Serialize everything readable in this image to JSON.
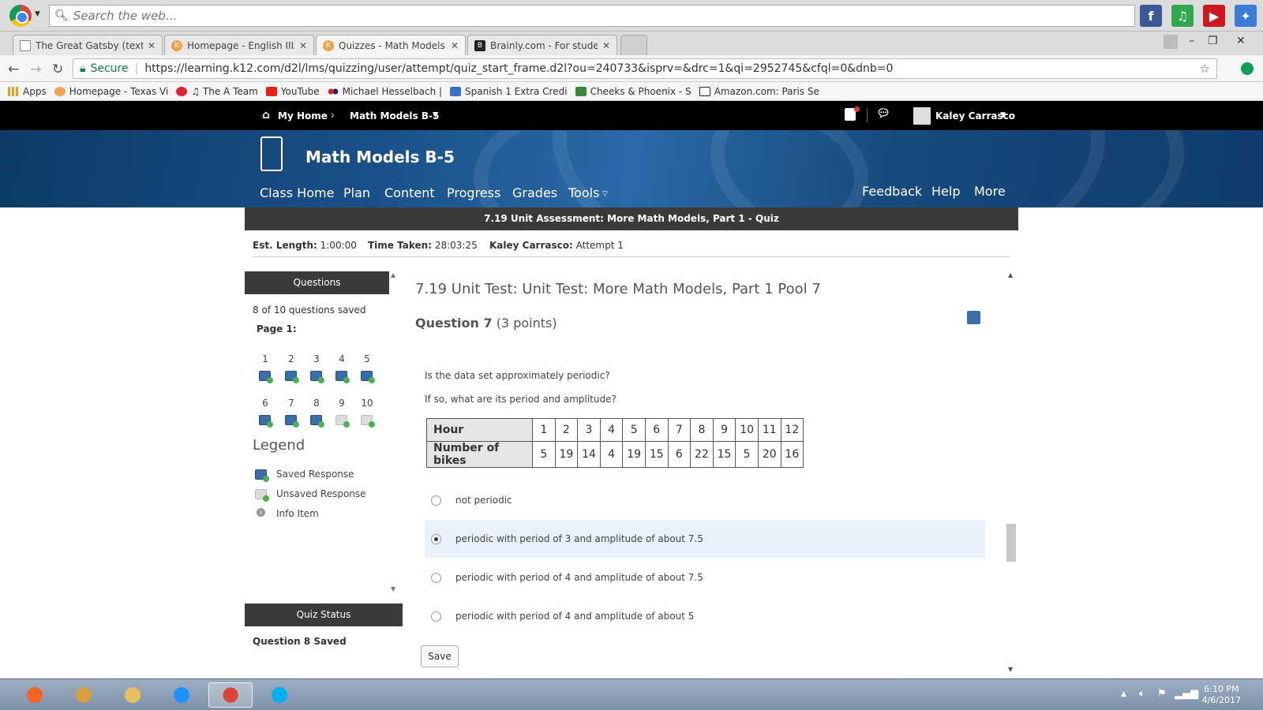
{
  "browser": {
    "search_placeholder": "Search the web...",
    "tabs": [
      {
        "title": "The Great Gatsby (text).p"
      },
      {
        "title": "Homepage - English IIIA"
      },
      {
        "title": "Quizzes - Math Models E"
      },
      {
        "title": "Brainly.com - For studen"
      }
    ],
    "secure_label": "Secure",
    "url": "https://learning.k12.com/d2l/lms/quizzing/user/attempt/quiz_start_frame.d2l?ou=240733&isprv=&drc=1&qi=2952745&cfql=0&dnb=0",
    "bookmarks": [
      {
        "label": "Apps",
        "color": "#e0a020"
      },
      {
        "label": "Homepage - Texas Vi",
        "color": "#f1a34b"
      },
      {
        "label": "♫ The A Team",
        "color": "#d23"
      },
      {
        "label": "YouTube",
        "color": "#e62117"
      },
      {
        "label": "Michael Hesselbach |",
        "color": "#c22"
      },
      {
        "label": "Spanish 1 Extra Credi",
        "color": "#3a6fc4"
      },
      {
        "label": "Cheeks & Phoenix - S",
        "color": "#3a8a3a"
      },
      {
        "label": "Amazon.com: Paris Se",
        "color": "#222"
      }
    ]
  },
  "site": {
    "my_home": "My Home",
    "course_dropdown": "Math Models B-5",
    "user_name": "Kaley Carrasco",
    "course_title": "Math Models B-5",
    "menu_left": [
      "Class Home",
      "Plan",
      "Content",
      "Progress",
      "Grades",
      "Tools"
    ],
    "menu_right": [
      "Feedback",
      "Help",
      "More"
    ]
  },
  "quiz": {
    "header": "7.19 Unit Assessment: More Math Models, Part 1 - Quiz",
    "est_length_label": "Est. Length:",
    "est_length": "1:00:00",
    "time_taken_label": "Time Taken:",
    "time_taken": "28:03:25",
    "attempt_user": "Kaley Carrasco:",
    "attempt": "Attempt 1"
  },
  "questions_panel": {
    "title": "Questions",
    "saved_count": "8 of 10 questions saved",
    "page_label": "Page 1:",
    "items": [
      {
        "num": "1",
        "status": "saved"
      },
      {
        "num": "2",
        "status": "saved"
      },
      {
        "num": "3",
        "status": "saved"
      },
      {
        "num": "4",
        "status": "saved"
      },
      {
        "num": "5",
        "status": "saved"
      },
      {
        "num": "6",
        "status": "saved"
      },
      {
        "num": "7",
        "status": "saved"
      },
      {
        "num": "8",
        "status": "saved"
      },
      {
        "num": "9",
        "status": "unsaved"
      },
      {
        "num": "10",
        "status": "unsaved"
      }
    ],
    "legend_title": "Legend",
    "legend_saved": "Saved Response",
    "legend_unsaved": "Unsaved Response",
    "legend_info": "Info Item"
  },
  "quiz_status": {
    "title": "Quiz Status",
    "text": "Question 8 Saved"
  },
  "question": {
    "section_title": "7.19 Unit Test: Unit Test: More Math Models, Part 1 Pool 7",
    "number_label": "Question 7",
    "points": "(3 points)",
    "prompt1": "Is the data set approximately periodic?",
    "prompt2": "If so, what are its period and amplitude?",
    "table": {
      "row1_label": "Hour",
      "row1": [
        "1",
        "2",
        "3",
        "4",
        "5",
        "6",
        "7",
        "8",
        "9",
        "10",
        "11",
        "12"
      ],
      "row2_label": "Number of bikes",
      "row2": [
        "5",
        "19",
        "14",
        "4",
        "19",
        "15",
        "6",
        "22",
        "15",
        "5",
        "20",
        "16"
      ]
    },
    "options": [
      {
        "label": "not periodic",
        "selected": false
      },
      {
        "label": "periodic with period of 3 and amplitude of about 7.5",
        "selected": true
      },
      {
        "label": "periodic with period of 4 and amplitude of about 7.5",
        "selected": false
      },
      {
        "label": "periodic with period of 4 and amplitude of about 5",
        "selected": false
      }
    ],
    "save_label": "Save"
  },
  "taskbar": {
    "time": "6:10 PM",
    "date": "4/6/2017"
  }
}
